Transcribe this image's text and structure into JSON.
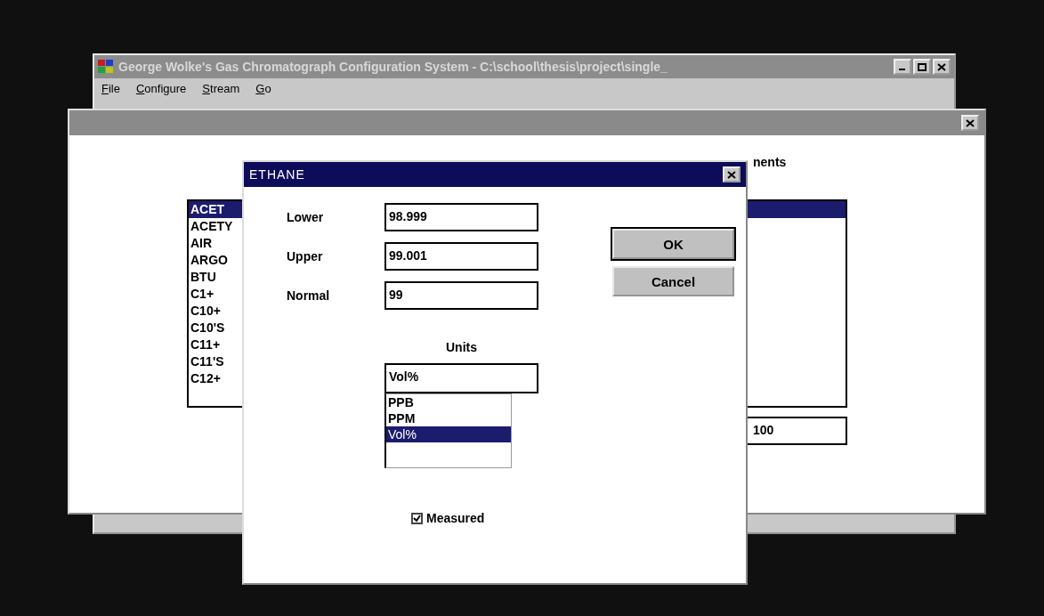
{
  "main_window": {
    "title": "George Wolke's Gas Chromatograph Configuration System - C:\\school\\thesis\\project\\single_",
    "menu": [
      {
        "label": "File"
      },
      {
        "label": "Configure"
      },
      {
        "label": "Stream"
      },
      {
        "label": "Go"
      }
    ]
  },
  "components_dialog": {
    "heading": "nents",
    "component_list": [
      {
        "label": "ACET",
        "selected": true
      },
      {
        "label": "ACETY",
        "selected": false
      },
      {
        "label": "AIR",
        "selected": false
      },
      {
        "label": "ARGO",
        "selected": false
      },
      {
        "label": "BTU",
        "selected": false
      },
      {
        "label": "C1+",
        "selected": false
      },
      {
        "label": "C10+",
        "selected": false
      },
      {
        "label": "C10'S",
        "selected": false
      },
      {
        "label": "C11+",
        "selected": false
      },
      {
        "label": "C11'S",
        "selected": false
      },
      {
        "label": "C12+",
        "selected": false
      }
    ],
    "chosen_list": [
      {
        "selected": true
      }
    ],
    "total_field": {
      "value": "100"
    }
  },
  "ethane_dialog": {
    "title": "ETHANE",
    "fields": [
      {
        "label": "Lower",
        "value": "98.999"
      },
      {
        "label": "Upper",
        "value": "99.001"
      },
      {
        "label": "Normal",
        "value": "99"
      }
    ],
    "buttons": [
      {
        "label": "OK",
        "default": true
      },
      {
        "label": "Cancel",
        "default": false
      }
    ],
    "units": {
      "label": "Units",
      "value": "Vol%",
      "options": [
        {
          "label": "PPB",
          "selected": false
        },
        {
          "label": "PPM",
          "selected": false
        },
        {
          "label": "Vol%",
          "selected": true
        }
      ]
    },
    "measured": {
      "label": "Measured",
      "checked": true
    }
  }
}
